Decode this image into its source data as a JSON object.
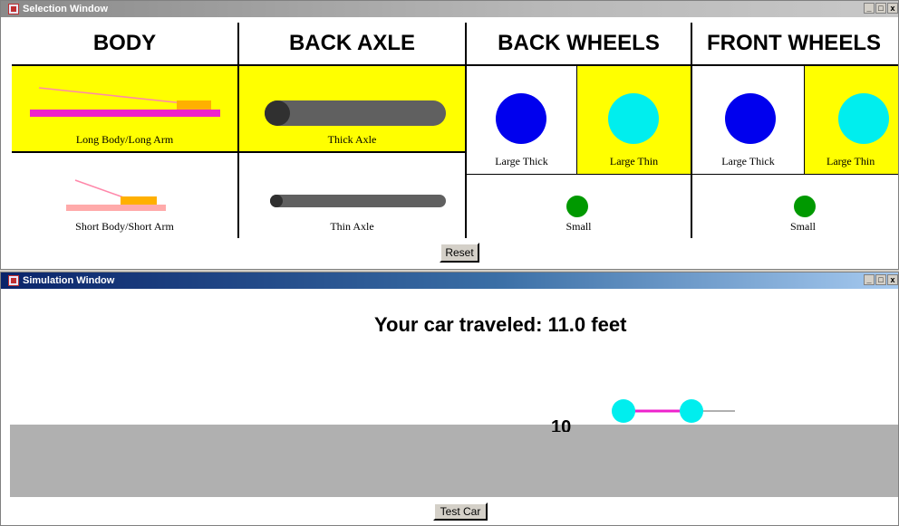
{
  "selection_window": {
    "title": "Selection Window",
    "controls": [
      "_",
      "□",
      "x"
    ],
    "columns": [
      {
        "header": "BODY",
        "options": [
          {
            "label": "Long Body/Long Arm",
            "selected": true
          },
          {
            "label": "Short Body/Short Arm",
            "selected": false
          }
        ]
      },
      {
        "header": "BACK AXLE",
        "options": [
          {
            "label": "Thick Axle",
            "selected": true
          },
          {
            "label": "Thin Axle",
            "selected": false
          }
        ]
      },
      {
        "header": "BACK WHEELS",
        "options": [
          {
            "label": "Large Thick",
            "selected": false
          },
          {
            "label": "Large Thin",
            "selected": true
          },
          {
            "label": "Small",
            "selected": false
          }
        ]
      },
      {
        "header": "FRONT WHEELS",
        "options": [
          {
            "label": "Large Thick",
            "selected": false
          },
          {
            "label": "Large Thin",
            "selected": true
          },
          {
            "label": "Small",
            "selected": false
          }
        ]
      }
    ],
    "reset_label": "Reset"
  },
  "simulation_window": {
    "title": "Simulation Window",
    "controls": [
      "_",
      "□",
      "x"
    ],
    "result_text": "Your car traveled: 11.0 feet",
    "distance_marker": "10",
    "test_button_label": "Test Car"
  },
  "colors": {
    "selected_bg": "#ffff00",
    "body_bar": "#ee22cc",
    "arm_line": "#ff88aa",
    "arm_block": "#ffb000",
    "axle": "#606060",
    "thick_wheel": "#0000ee",
    "thin_wheel": "#00eeee",
    "small_wheel": "#009900",
    "road": "#b0b0b0"
  }
}
